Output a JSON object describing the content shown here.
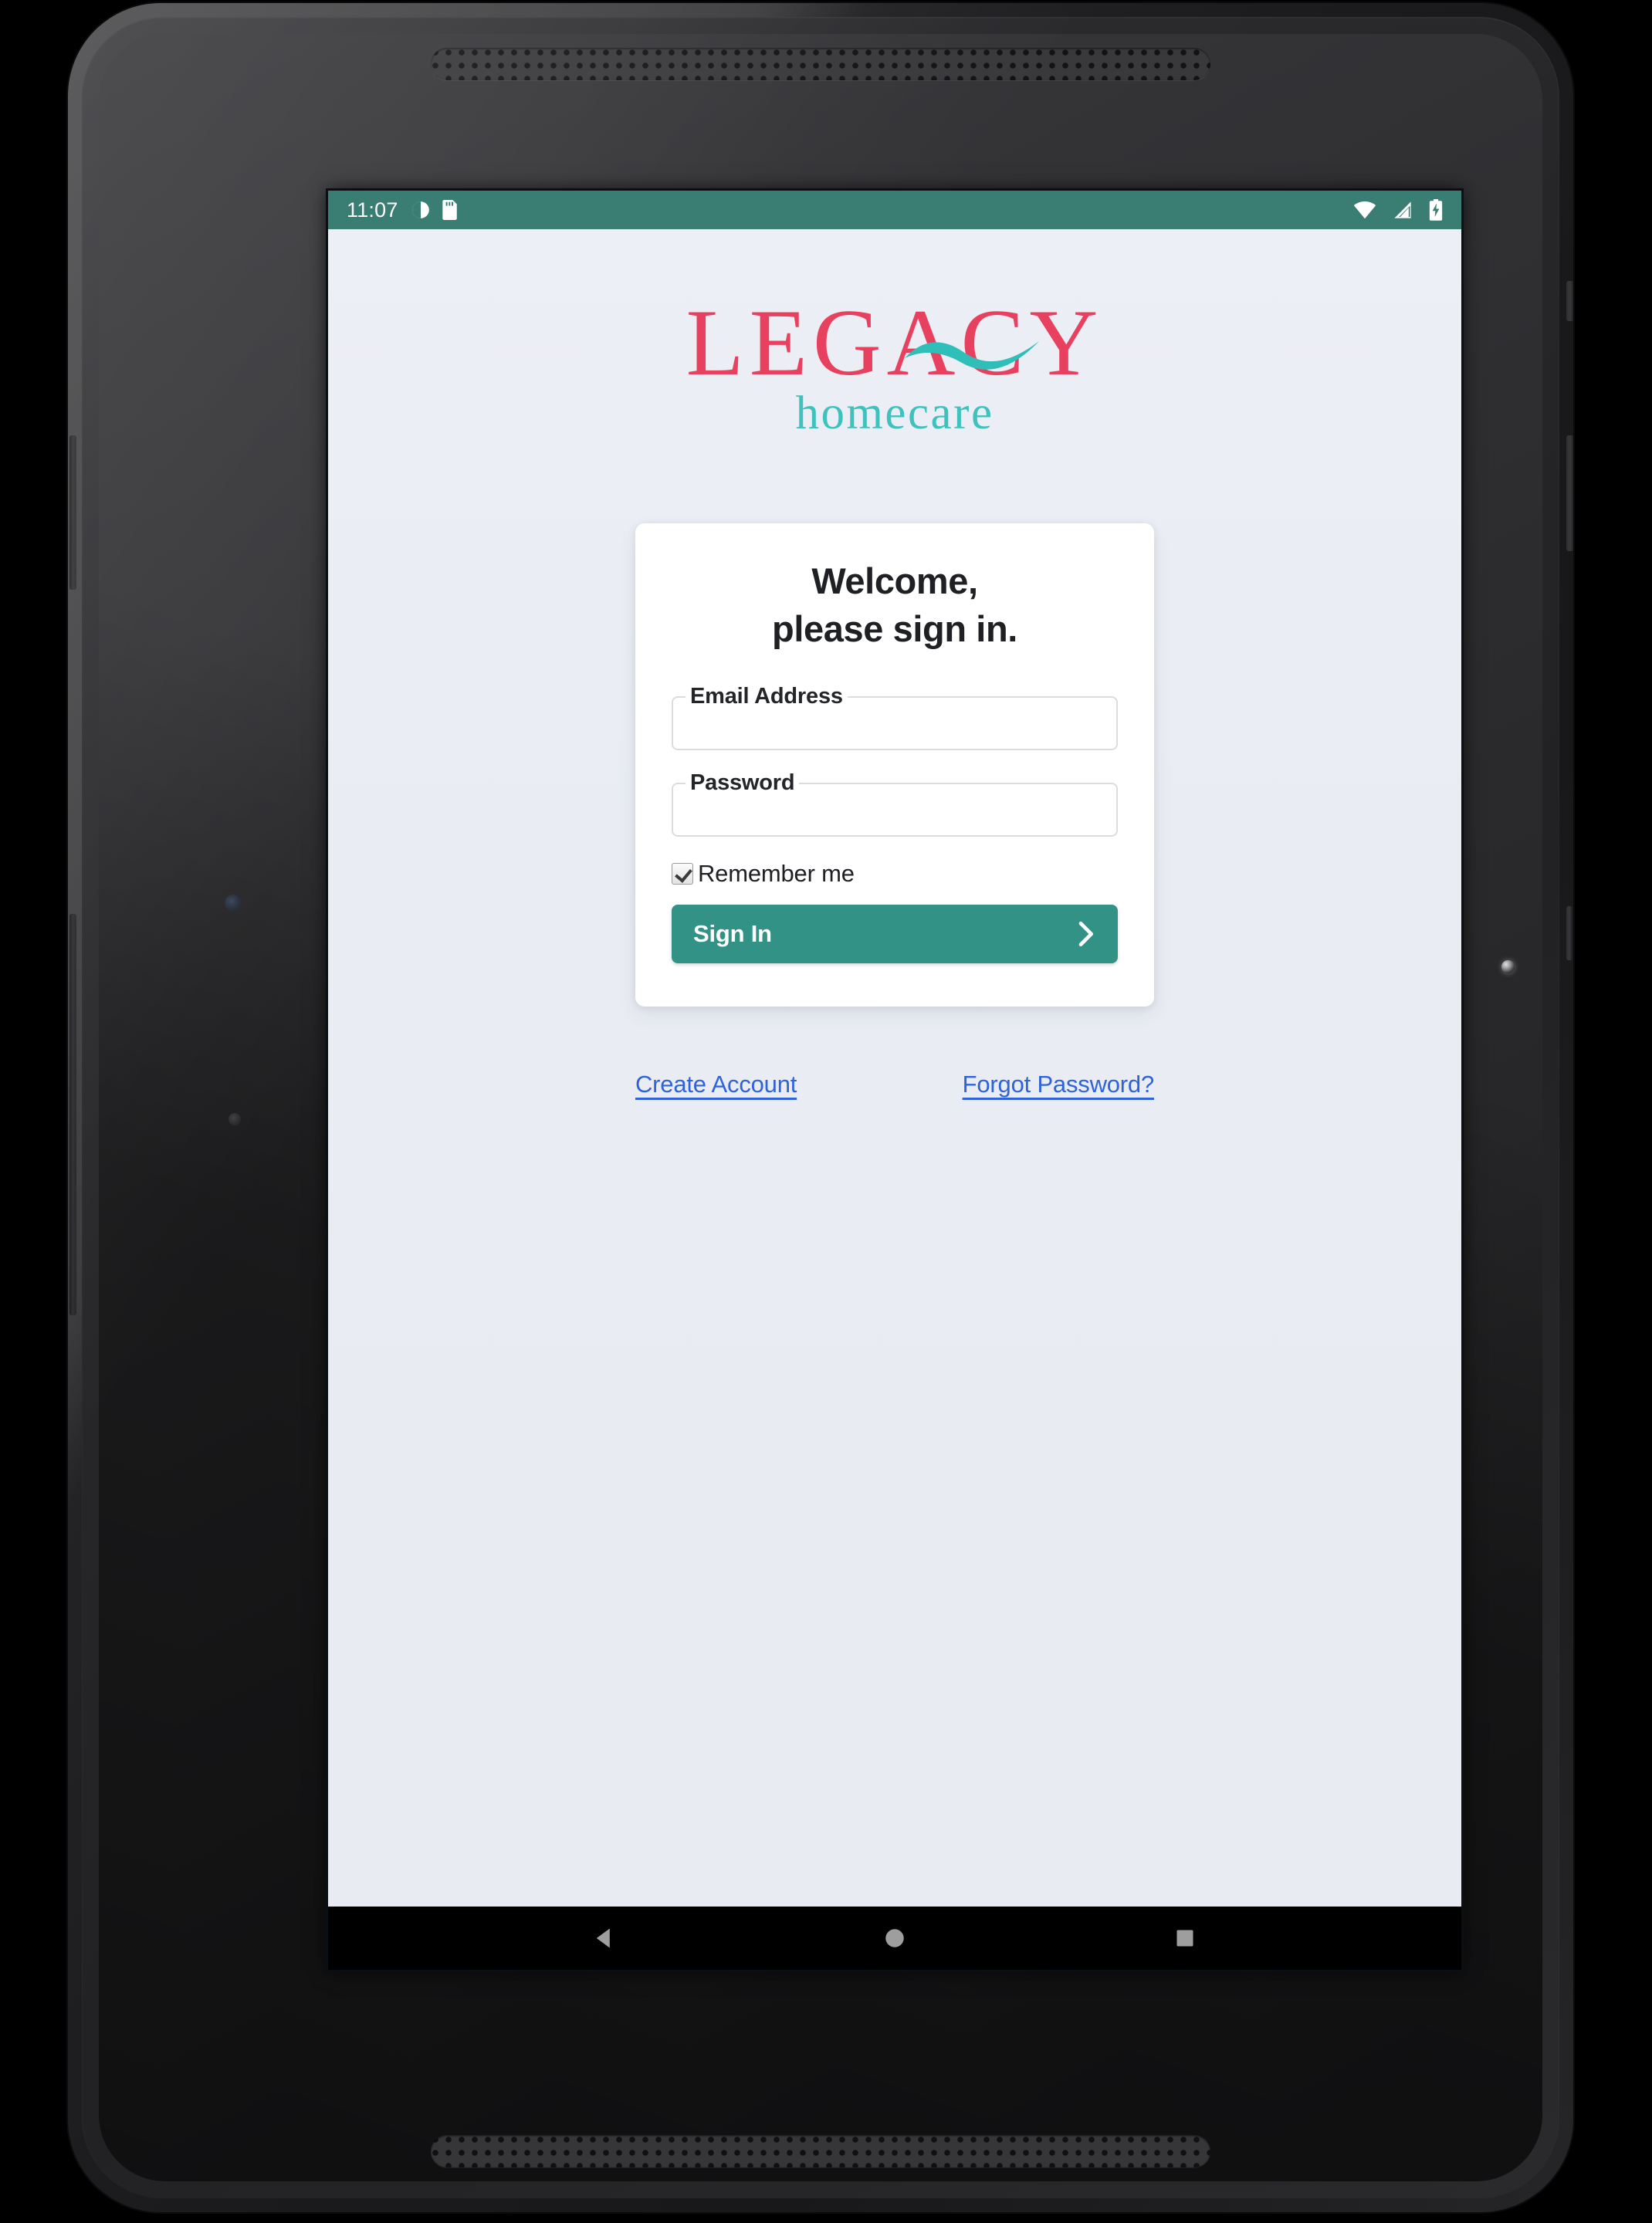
{
  "device": {
    "type": "android-tablet-mockup",
    "grille_top": "speaker-grille",
    "grille_bottom": "speaker-grille"
  },
  "status_bar": {
    "time": "11:07",
    "left_icons": [
      "do-not-disturb-icon",
      "sd-card-icon"
    ],
    "right_icons": [
      "wifi-icon",
      "cellular-signal-icon",
      "battery-charging-icon"
    ],
    "background_color": "#3a7d72",
    "foreground_color": "#ffffff"
  },
  "brand": {
    "wordmark": "LEGACY",
    "tagline": "homecare",
    "wordmark_color": "#e8415f",
    "tagline_color": "#3fc2bd",
    "swoosh_color": "#2fbfb8"
  },
  "card": {
    "heading_line1": "Welcome,",
    "heading_line2": "please sign in.",
    "fields": [
      {
        "name": "email",
        "label": "Email Address",
        "value": "",
        "placeholder": ""
      },
      {
        "name": "password",
        "label": "Password",
        "value": "",
        "placeholder": ""
      }
    ],
    "remember": {
      "label": "Remember me",
      "checked": true
    },
    "submit": {
      "label": "Sign In",
      "icon": "chevron-right-icon",
      "background_color": "#329286",
      "text_color": "#ffffff"
    }
  },
  "footer_links": {
    "create_account": "Create Account",
    "forgot_password": "Forgot Password?",
    "color": "#2f63d8"
  },
  "nav_bar": {
    "back": "back-triangle-icon",
    "home": "home-circle-icon",
    "recents": "recents-square-icon",
    "background_color": "#000000",
    "icon_color": "#9e9e9e"
  },
  "page": {
    "background_color": "#e9ecf3"
  }
}
